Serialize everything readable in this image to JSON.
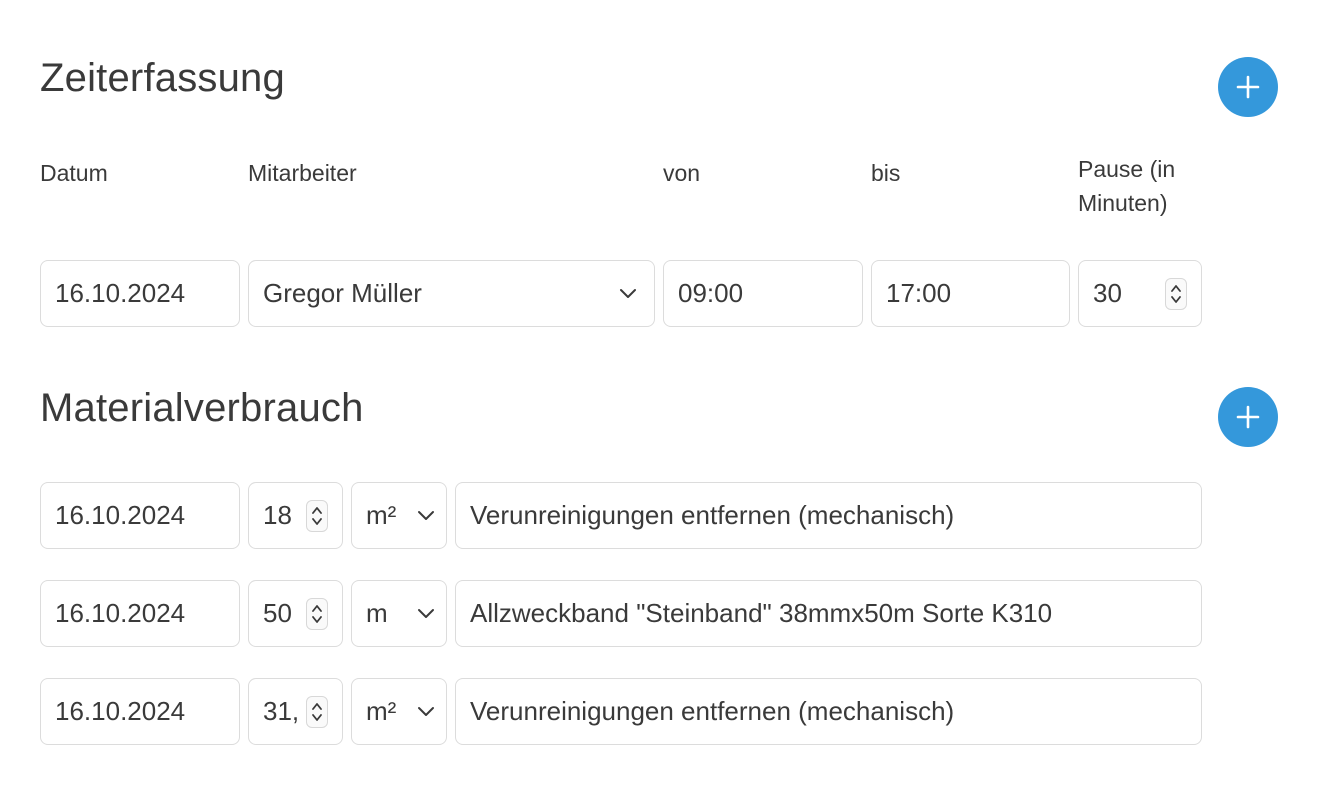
{
  "zeiterfassung": {
    "title": "Zeiterfassung",
    "add_label": "+",
    "columns": {
      "datum": "Datum",
      "mitarbeiter": "Mitarbeiter",
      "von": "von",
      "bis": "bis",
      "pause_line1": "Pause (in",
      "pause_line2": "Minuten)"
    },
    "entry": {
      "datum": "16.10.2024",
      "mitarbeiter": "Gregor Müller",
      "von": "09:00",
      "bis": "17:00",
      "pause": "30"
    }
  },
  "materialverbrauch": {
    "title": "Materialverbrauch",
    "add_label": "+",
    "rows": [
      {
        "datum": "16.10.2024",
        "menge": "18",
        "einheit": "m²",
        "beschreibung": "Verunreinigungen entfernen (mechanisch)"
      },
      {
        "datum": "16.10.2024",
        "menge": "50",
        "einheit": "m",
        "beschreibung": "Allzweckband \"Steinband\" 38mmx50m Sorte K310"
      },
      {
        "datum": "16.10.2024",
        "menge": "31,",
        "einheit": "m²",
        "beschreibung": "Verunreinigungen entfernen (mechanisch)"
      }
    ]
  },
  "colors": {
    "accent": "#3498db",
    "text": "#3a3a3a",
    "border": "#dcdcdc"
  },
  "icons": {
    "add": "plus-icon",
    "dropdown": "chevron-down-icon",
    "stepper": "spinner-arrows-icon"
  }
}
